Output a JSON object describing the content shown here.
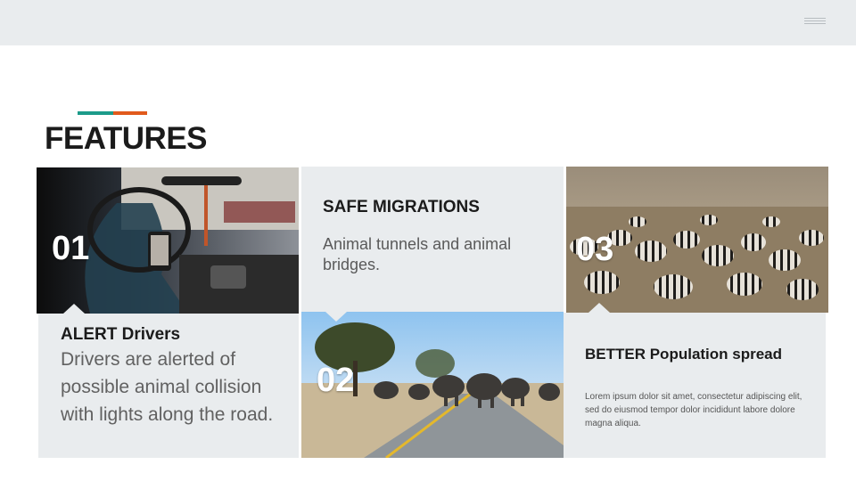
{
  "header": {
    "menu_icon": "hamburger-menu-icon"
  },
  "accent_colors": {
    "teal": "#1c9b8a",
    "orange": "#e15a1c"
  },
  "page": {
    "title": "FEATURES"
  },
  "features": [
    {
      "number": "01",
      "title": "ALERT  Drivers",
      "body": "Drivers are alerted of possible animal collision with lights along the road."
    },
    {
      "number": "02",
      "title": "SAFE MIGRATIONS",
      "body": "Animal tunnels and animal bridges."
    },
    {
      "number": "03",
      "title": "BETTER Population spread",
      "body": "Lorem ipsum dolor sit amet, consectetur adipiscing elit, sed do eiusmod tempor dolor incididunt labore dolore magna aliqua."
    }
  ]
}
